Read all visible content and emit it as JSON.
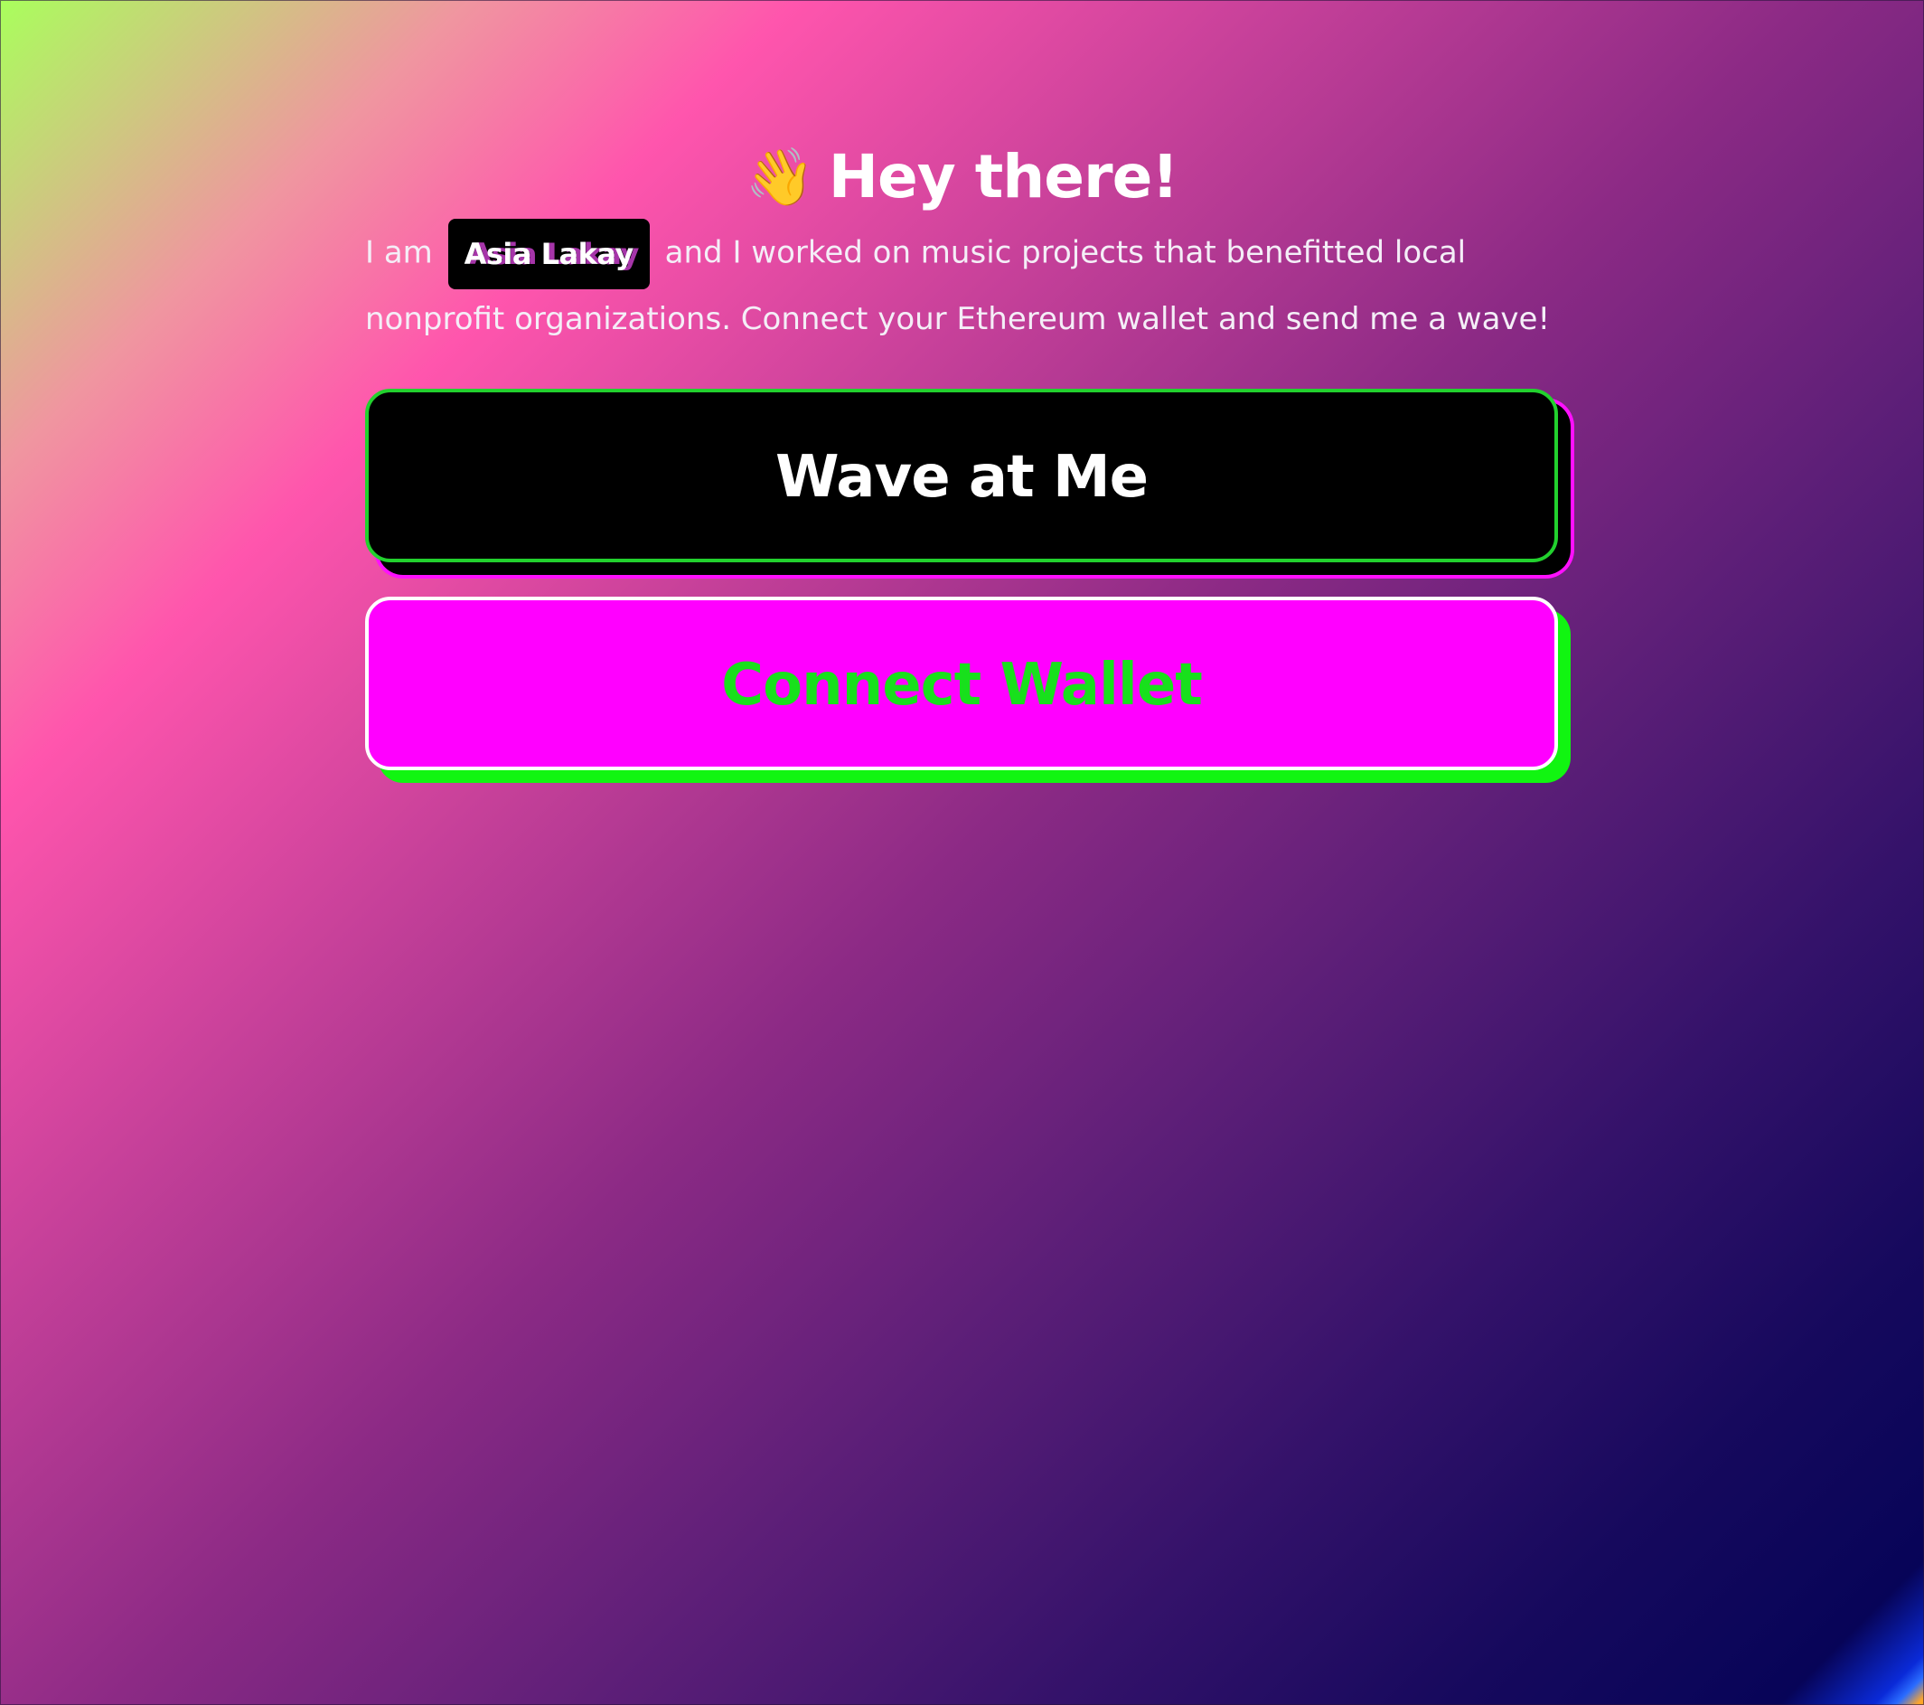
{
  "background": {
    "gradient_colors": [
      "#a9ff5c",
      "#ff55ad",
      "#8c2a85",
      "#070458",
      "#2a6cff",
      "#ffa629"
    ]
  },
  "header": {
    "emoji": "👋",
    "title": "Hey there!"
  },
  "bio": {
    "prefix": "I am",
    "name": "Asia Lakay",
    "suffix": "and I worked on music projects that benefitted local nonprofit organizations. Connect your Ethereum wallet and send me a wave!"
  },
  "buttons": {
    "wave_label": "Wave at Me",
    "connect_label": "Connect Wallet"
  },
  "colors": {
    "wave_button_bg": "#000000",
    "wave_button_border": "#22d12e",
    "wave_button_shadow_outline": "#ff10ff",
    "connect_button_bg": "#ff00ff",
    "connect_button_text": "#18e01c",
    "connect_button_shadow": "#11f511"
  }
}
